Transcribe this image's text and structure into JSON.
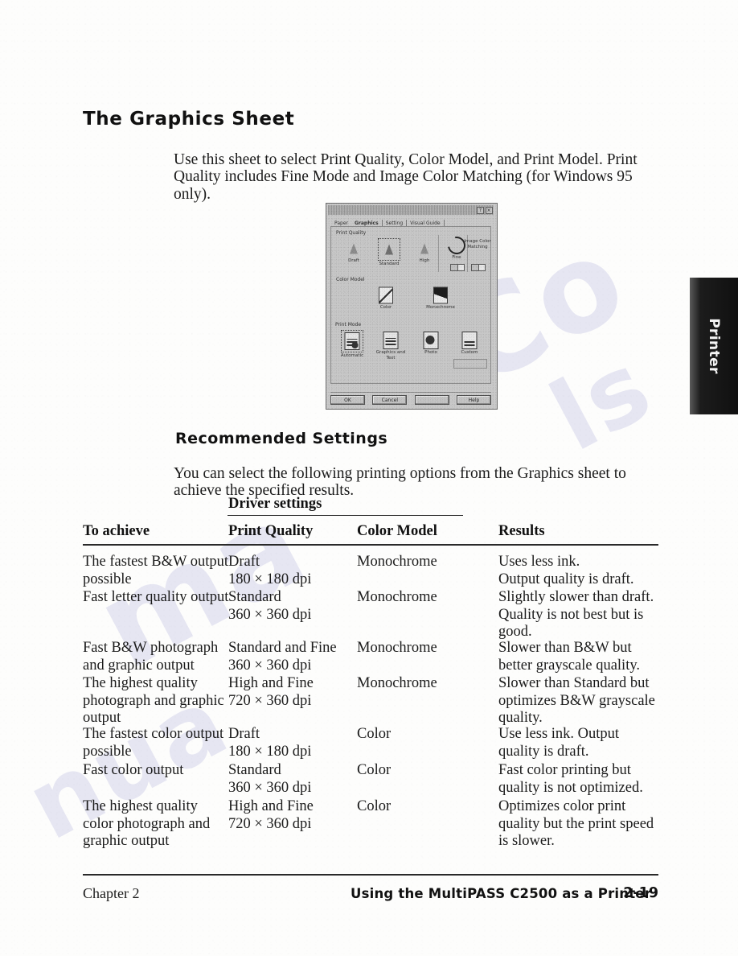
{
  "page": {
    "title": "The Graphics Sheet",
    "intro": "Use this sheet to select Print Quality, Color Model, and Print Model. Print Quality includes Fine Mode and Image Color Matching (for Windows 95 only).",
    "section_title": "Recommended Settings",
    "section_intro": "You can select the following printing options from the Graphics sheet to achieve the specified results."
  },
  "thumb_tab": {
    "label": "Printer"
  },
  "dialog": {
    "title": "",
    "help_button": "?",
    "close_button": "×",
    "tabs": [
      {
        "label": "Paper",
        "active": false
      },
      {
        "label": "Graphics",
        "active": true
      },
      {
        "label": "Setting",
        "active": false
      },
      {
        "label": "Visual Guide",
        "active": false
      }
    ],
    "print_quality": {
      "group_label": "Print Quality",
      "options": [
        {
          "label": "Draft",
          "selected": false
        },
        {
          "label": "Standard",
          "selected": true
        },
        {
          "label": "High",
          "selected": false
        }
      ],
      "fine": {
        "label": "Fine",
        "state": "on"
      },
      "image_color_matching": {
        "label": "Image Color Matching",
        "state": "on"
      }
    },
    "color_model": {
      "group_label": "Color Model",
      "options": [
        {
          "label": "Color"
        },
        {
          "label": "Monochrome"
        }
      ]
    },
    "print_mode": {
      "group_label": "Print Mode",
      "options": [
        {
          "label": "Automatic",
          "selected": true
        },
        {
          "label": "Graphics and Text",
          "selected": false
        },
        {
          "label": "Photo",
          "selected": false
        },
        {
          "label": "Custom",
          "selected": false
        }
      ]
    },
    "buttons": [
      {
        "label": "OK",
        "enabled": true
      },
      {
        "label": "Cancel",
        "enabled": true
      },
      {
        "label": "",
        "enabled": false
      },
      {
        "label": "Help",
        "enabled": true
      }
    ]
  },
  "table": {
    "group_header": "Driver settings",
    "columns": [
      "To achieve",
      "Print Quality",
      "Color Model",
      "Results"
    ],
    "rows": [
      {
        "achieve": "The fastest B&W output possible",
        "print_quality": "Draft\n180 × 180 dpi",
        "color_model": "Monochrome",
        "results": "Uses less ink.\nOutput quality is draft."
      },
      {
        "achieve": "Fast letter quality output",
        "print_quality": "Standard\n360 × 360 dpi",
        "color_model": "Monochrome",
        "results": "Slightly slower than draft. Quality is not best but is good."
      },
      {
        "achieve": "Fast B&W photograph and graphic output",
        "print_quality": "Standard and Fine\n360 × 360 dpi",
        "color_model": "Monochrome",
        "results": "Slower than B&W but better grayscale quality."
      },
      {
        "achieve": "The highest quality photograph and graphic output",
        "print_quality": "High and Fine\n720 × 360 dpi",
        "color_model": "Monochrome",
        "results": "Slower than Standard but optimizes B&W grayscale quality."
      },
      {
        "achieve": "The fastest color output possible",
        "print_quality": "Draft\n180 × 180 dpi",
        "color_model": "Color",
        "results": "Use less ink. Output quality is draft."
      },
      {
        "achieve": "Fast color output",
        "print_quality": "Standard\n360 × 360 dpi",
        "color_model": "Color",
        "results": "Fast color printing but quality is not optimized."
      },
      {
        "achieve": "The highest quality color photograph and graphic output",
        "print_quality": "High and Fine\n720 × 360 dpi",
        "color_model": "Color",
        "results": "Optimizes color print quality but the print speed is slower."
      }
    ]
  },
  "footer": {
    "left": "Chapter 2",
    "center": "Using the MultiPASS C2500 as a Printer",
    "page_number": "2-19"
  },
  "watermark": {
    "fragments": [
      "Co",
      "ma",
      "nua",
      "ls"
    ]
  }
}
